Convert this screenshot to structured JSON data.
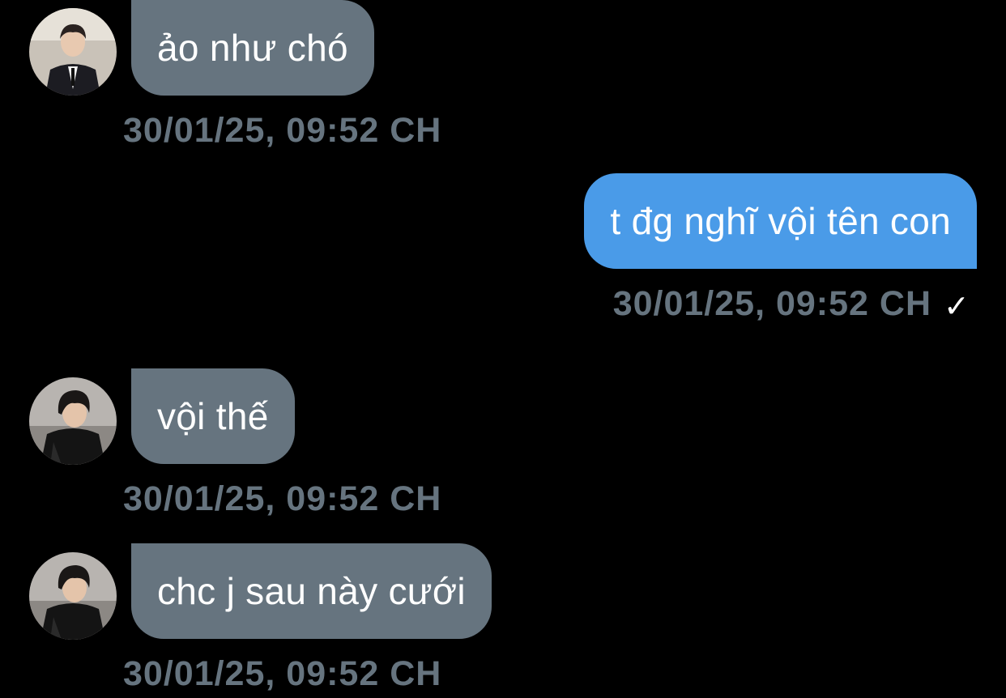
{
  "colors": {
    "background": "#000000",
    "incoming_bubble": "#66747f",
    "outgoing_bubble": "#4a9be8",
    "timestamp": "#66747f",
    "text": "#ffffff"
  },
  "messages": [
    {
      "direction": "incoming",
      "text": "ảo như chó",
      "time": "30/01/25, 09:52 CH"
    },
    {
      "direction": "outgoing",
      "text": "t đg nghĩ vội tên con",
      "time": "30/01/25, 09:52 CH",
      "status_icon": "✓"
    },
    {
      "direction": "incoming",
      "text": "vội thế",
      "time": "30/01/25, 09:52 CH"
    },
    {
      "direction": "incoming",
      "text": "chc j sau này cưới",
      "time": "30/01/25, 09:52 CH"
    }
  ]
}
